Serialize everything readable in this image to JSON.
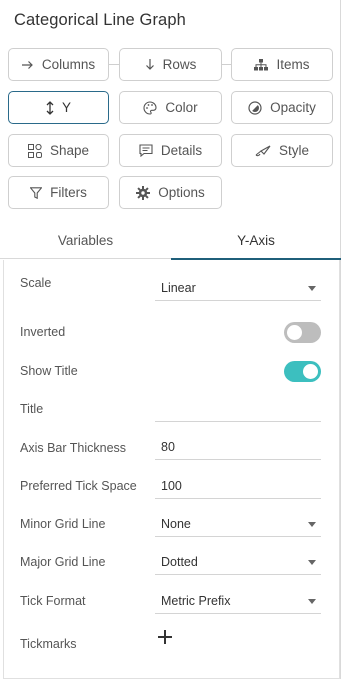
{
  "header": {
    "title": "Categorical Line Graph"
  },
  "buttons": {
    "columns": {
      "label": "Columns",
      "icon": "arrow-right-icon"
    },
    "rows": {
      "label": "Rows",
      "icon": "arrow-down-icon"
    },
    "items": {
      "label": "Items",
      "icon": "hierarchy-icon"
    },
    "y": {
      "label": "Y",
      "icon": "vertical-arrows-icon"
    },
    "color": {
      "label": "Color",
      "icon": "palette-icon"
    },
    "opacity": {
      "label": "Opacity",
      "icon": "opacity-icon"
    },
    "shape": {
      "label": "Shape",
      "icon": "shapes-icon"
    },
    "details": {
      "label": "Details",
      "icon": "comment-icon"
    },
    "style": {
      "label": "Style",
      "icon": "brush-icon"
    },
    "filters": {
      "label": "Filters",
      "icon": "filter-icon"
    },
    "options": {
      "label": "Options",
      "icon": "gear-icon"
    }
  },
  "tabs": [
    {
      "label": "Variables",
      "active": false
    },
    {
      "label": "Y-Axis",
      "active": true
    }
  ],
  "settings": {
    "scale": {
      "label": "Scale",
      "value": "Linear"
    },
    "inverted": {
      "label": "Inverted",
      "on": false
    },
    "show_title": {
      "label": "Show Title",
      "on": true
    },
    "title": {
      "label": "Title",
      "value": ""
    },
    "axis_bar_thickness": {
      "label": "Axis Bar Thickness",
      "value": "80"
    },
    "preferred_tick_space": {
      "label": "Preferred Tick Space",
      "value": "100"
    },
    "minor_grid_line": {
      "label": "Minor Grid Line",
      "value": "None"
    },
    "major_grid_line": {
      "label": "Major Grid Line",
      "value": "Dotted"
    },
    "tick_format": {
      "label": "Tick Format",
      "value": "Metric Prefix"
    },
    "tickmarks": {
      "label": "Tickmarks"
    }
  },
  "colors": {
    "accent": "#1f5f7a",
    "toggle_on": "#3cbfbf",
    "toggle_off": "#bdbdbd"
  }
}
